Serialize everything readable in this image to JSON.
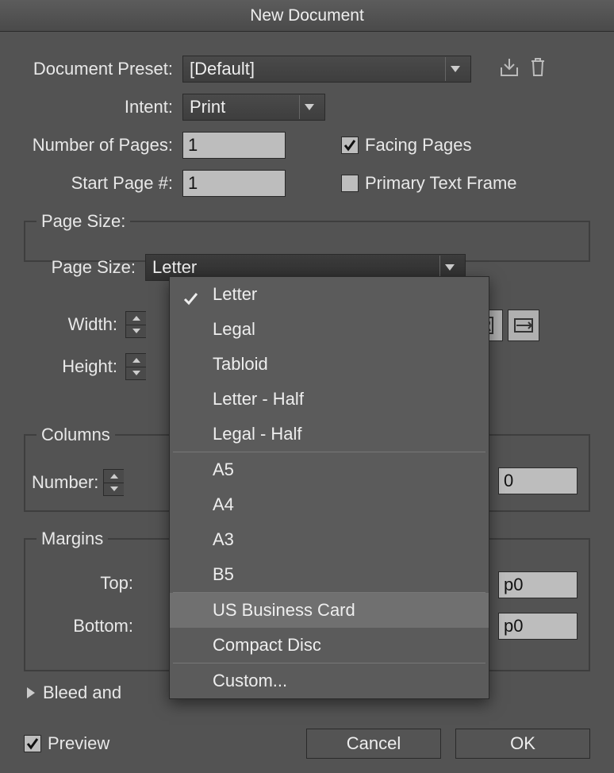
{
  "title": "New Document",
  "labels": {
    "documentPreset": "Document Preset:",
    "intent": "Intent:",
    "numberOfPages": "Number of Pages:",
    "startPage": "Start Page #:",
    "pageSize": "Page Size:",
    "width": "Width:",
    "height": "Height:",
    "columns": "Columns",
    "number": "Number:",
    "margins": "Margins",
    "top": "Top:",
    "bottom": "Bottom:",
    "facingPages": "Facing Pages",
    "primaryTextFrame": "Primary Text Frame",
    "bleedAndSlug": "Bleed and",
    "preview": "Preview",
    "cancel": "Cancel",
    "ok": "OK"
  },
  "values": {
    "documentPreset": "[Default]",
    "intent": "Print",
    "numberOfPages": "1",
    "startPage": "1",
    "pageSize": "Letter",
    "columnsNumberSuffix": "0",
    "marginTopSuffix": "p0",
    "marginBottomSuffix": "p0",
    "facingPagesChecked": true,
    "primaryTextFrameChecked": false,
    "previewChecked": true
  },
  "pageSizeMenu": {
    "selected": "Letter",
    "highlighted": "US Business Card",
    "groups": [
      [
        "Letter",
        "Legal",
        "Tabloid",
        "Letter - Half",
        "Legal - Half"
      ],
      [
        "A5",
        "A4",
        "A3",
        "B5"
      ],
      [
        "US Business Card",
        "Compact Disc"
      ],
      [
        "Custom..."
      ]
    ]
  }
}
